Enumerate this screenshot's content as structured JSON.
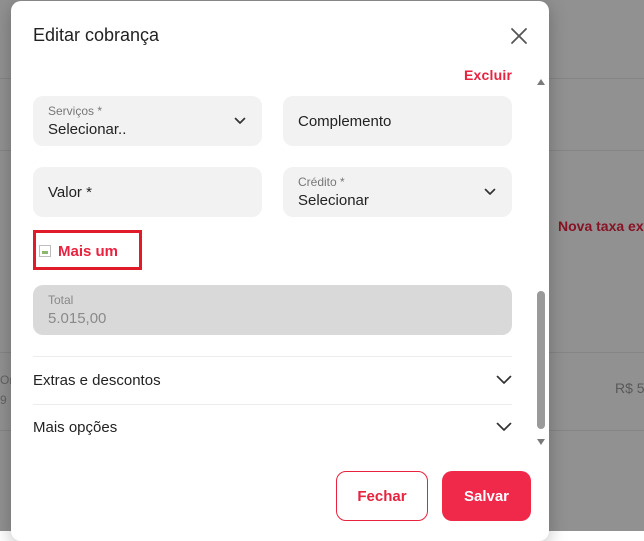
{
  "background": {
    "link_text": "Nova taxa ex",
    "amount_text": "R$ 5",
    "left_fragments": [
      "Or",
      "9"
    ]
  },
  "modal": {
    "title": "Editar cobrança",
    "delete_label": "Excluir",
    "services": {
      "label": "Serviços *",
      "value": "Selecionar.."
    },
    "complement": {
      "placeholder": "Complemento"
    },
    "value_field": {
      "placeholder": "Valor *"
    },
    "credit": {
      "label": "Crédito *",
      "value": "Selecionar"
    },
    "more_button_label": "Mais um",
    "total": {
      "label": "Total",
      "value": "5.015,00"
    },
    "accordions": [
      {
        "label": "Extras e descontos"
      },
      {
        "label": "Mais opções"
      }
    ],
    "buttons": {
      "close": "Fechar",
      "save": "Salvar"
    }
  },
  "icons": {
    "close": "close-icon",
    "chevron": "chevron-down-icon",
    "broken_image": "broken-image-icon"
  },
  "colors": {
    "accent": "#e8223f",
    "save_bg": "#f0294a",
    "field_bg": "#f2f2f2",
    "total_bg": "#d9d9d9",
    "highlight_border": "#e01b2a"
  }
}
